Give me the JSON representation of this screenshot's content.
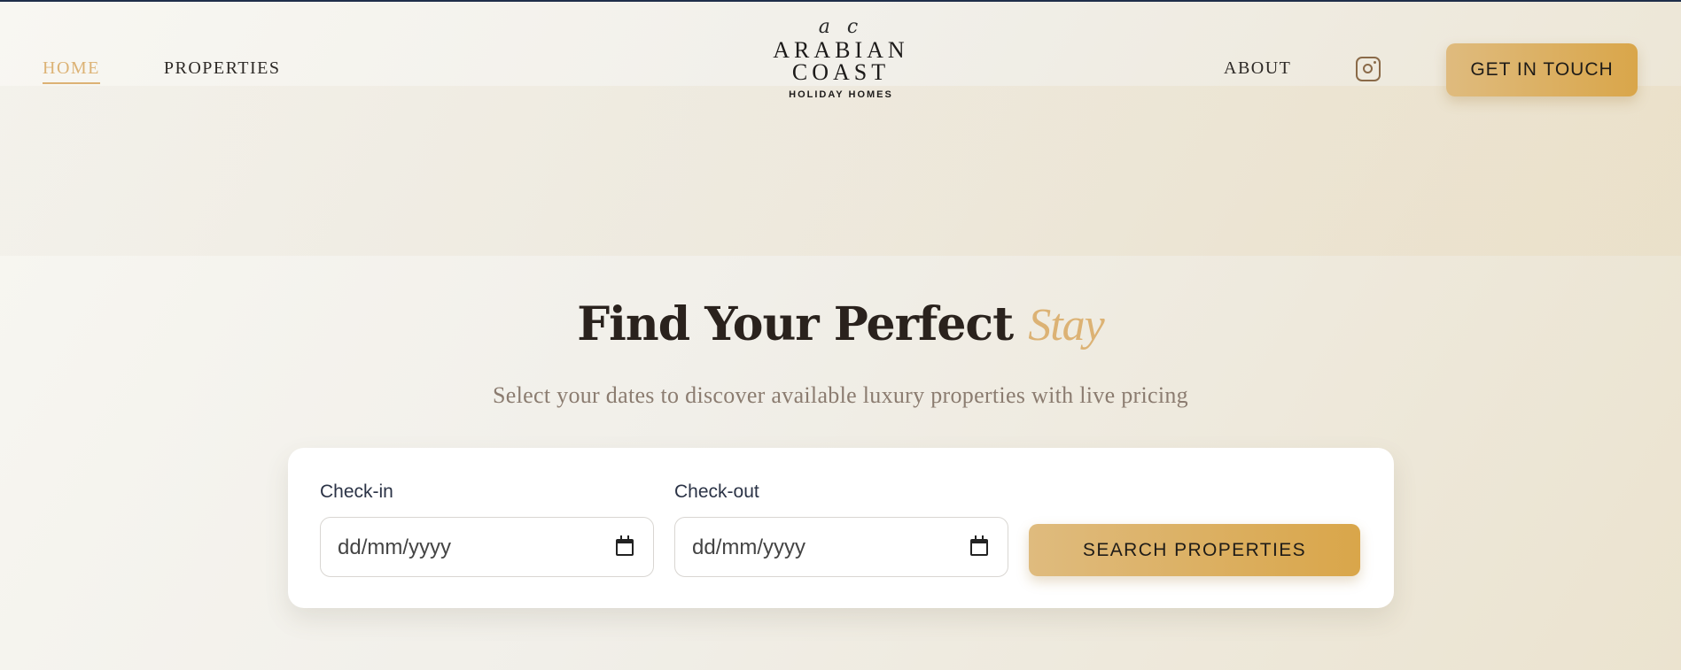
{
  "header": {
    "nav_left": [
      {
        "label": "HOME",
        "active": true
      },
      {
        "label": "PROPERTIES",
        "active": false
      }
    ],
    "logo": {
      "script": "a c",
      "line1": "ARABIAN",
      "line2": "COAST",
      "tagline": "HOLIDAY HOMES"
    },
    "nav_right": {
      "about": "ABOUT"
    },
    "social_icon": "instagram-icon",
    "cta_label": "GET IN TOUCH"
  },
  "hero": {
    "title_main": "Find Your Perfect",
    "title_accent": "Stay",
    "subtitle": "Select your dates to discover available luxury properties with live pricing"
  },
  "search": {
    "checkin_label": "Check-in",
    "checkin_placeholder": "dd/mm/yyyy",
    "checkout_label": "Check-out",
    "checkout_placeholder": "dd/mm/yyyy",
    "button_label": "SEARCH PROPERTIES"
  },
  "colors": {
    "accent_gold": "#dcb274",
    "button_gold": "#d9a64a",
    "text_dark": "#2a221d",
    "subtitle": "#8b7c70"
  }
}
